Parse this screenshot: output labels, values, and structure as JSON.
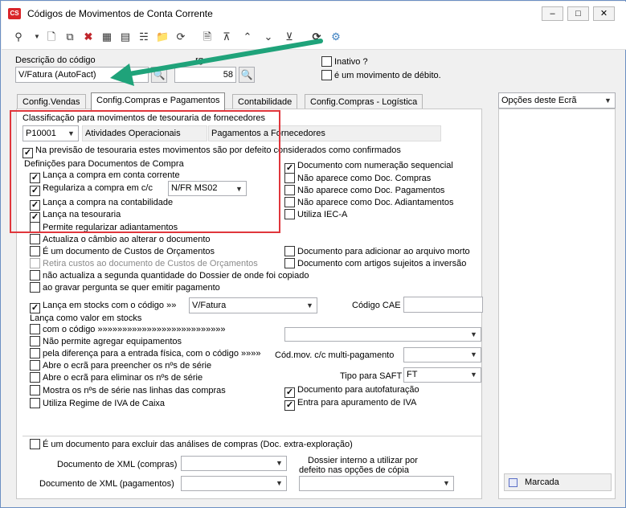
{
  "window": {
    "title": "Códigos de Movimentos de Conta Corrente",
    "app_icon": "CS",
    "minimize": "–",
    "maximize": "□",
    "close": "✕"
  },
  "header": {
    "descricao_label": "Descrição do código",
    "descricao_value": "V/Fatura (AutoFact)",
    "numero_label": "...rg",
    "numero_value": "58",
    "inativo_label": "Inativo ?",
    "debito_label": "é um movimento de débito."
  },
  "tabs": [
    {
      "label": "Config.Vendas"
    },
    {
      "label": "Config.Compras e Pagamentos"
    },
    {
      "label": "Contabilidade"
    },
    {
      "label": "Config.Compras - Logística"
    }
  ],
  "classificacao": {
    "label": "Classificação para movimentos de tesouraria de fornecedores",
    "code": "P10001",
    "group": "Atividades Operacionais",
    "desc": "Pagamentos a Fornecedores"
  },
  "previsao_label": "Na previsão de tesouraria estes movimentos são por defeito considerados como confirmados",
  "definicoes_label": "Definições para Documentos de Compra",
  "left_checks": [
    {
      "label": "Lança a compra em conta corrente",
      "checked": "✓"
    },
    {
      "label": "Regulariza a compra em c/c",
      "checked": "✓"
    },
    {
      "label": "Lança a compra na contabilidade",
      "checked": "✓"
    },
    {
      "label": "Lança na tesouraria",
      "checked": "✓"
    },
    {
      "label": "Permite regularizar adiantamentos",
      "checked": ""
    },
    {
      "label": "Actualiza o câmbio ao alterar o documento",
      "checked": ""
    },
    {
      "label": "É um documento de Custos de Orçamentos",
      "checked": ""
    },
    {
      "label": "Retira custos ao documento de Custos de Orçamentos",
      "checked": ""
    },
    {
      "label": "não actualiza a segunda quantidade do Dossier de onde foi copiado",
      "checked": ""
    },
    {
      "label": "ao gravar pergunta se quer emitir pagamento",
      "checked": ""
    }
  ],
  "regulariza_value": "N/FR MS02",
  "right_checks": [
    {
      "label": "Documento com numeração sequencial",
      "checked": "✓"
    },
    {
      "label": "Não aparece como Doc. Compras",
      "checked": ""
    },
    {
      "label": "Não aparece como Doc. Pagamentos",
      "checked": ""
    },
    {
      "label": "Não aparece como Doc. Adiantamentos",
      "checked": ""
    },
    {
      "label": "Utiliza IEC-A",
      "checked": ""
    },
    {
      "label": "Documento para adicionar ao arquivo morto",
      "checked": ""
    },
    {
      "label": "Documento com artigos sujeitos a inversão",
      "checked": ""
    }
  ],
  "stocks": {
    "lanca_label": "Lança em stocks com o código »»",
    "lanca_value": "V/Fatura",
    "cae_label": "Código CAE",
    "valor_label": "Lança como valor em stocks",
    "com_codigo_label": "com o código »»»»»»»»»»»»»»»»»»»»»»»»»»",
    "nao_agregar_label": "Não permite agregar equipamentos",
    "diferenca_label": "pela diferença para a entrada física, com o código »»»»",
    "preencher_label": "Abre o ecrã para preencher os nºs de série",
    "eliminar_label": "Abre o ecrã para eliminar os nºs de série",
    "mostra_label": "Mostra os nºs de série nas linhas das compras",
    "iva_caixa_label": "Utiliza Regime de IVA de Caixa",
    "multi_label": "Cód.mov. c/c multi-pagamento",
    "saft_label": "Tipo para SAFT",
    "saft_value": "FT",
    "autofat_label": "Documento para autofaturação",
    "apuramento_label": "Entra para apuramento de IVA",
    "check": "✓"
  },
  "footer": {
    "excluir_label": "É um documento para excluir das análises de compras (Doc. extra-exploração)",
    "xml_compras_label": "Documento de XML (compras)",
    "xml_pag_label": "Documento de XML (pagamentos)",
    "dossier_label_1": "Dossier interno a utilizar por",
    "dossier_label_2": "defeito nas opções de cópia"
  },
  "right": {
    "options_label": "Opções deste Ecrã",
    "marcada_label": "Marcada"
  },
  "colors": {
    "red_box": "#e0363c",
    "arrow": "#1fa37a"
  }
}
